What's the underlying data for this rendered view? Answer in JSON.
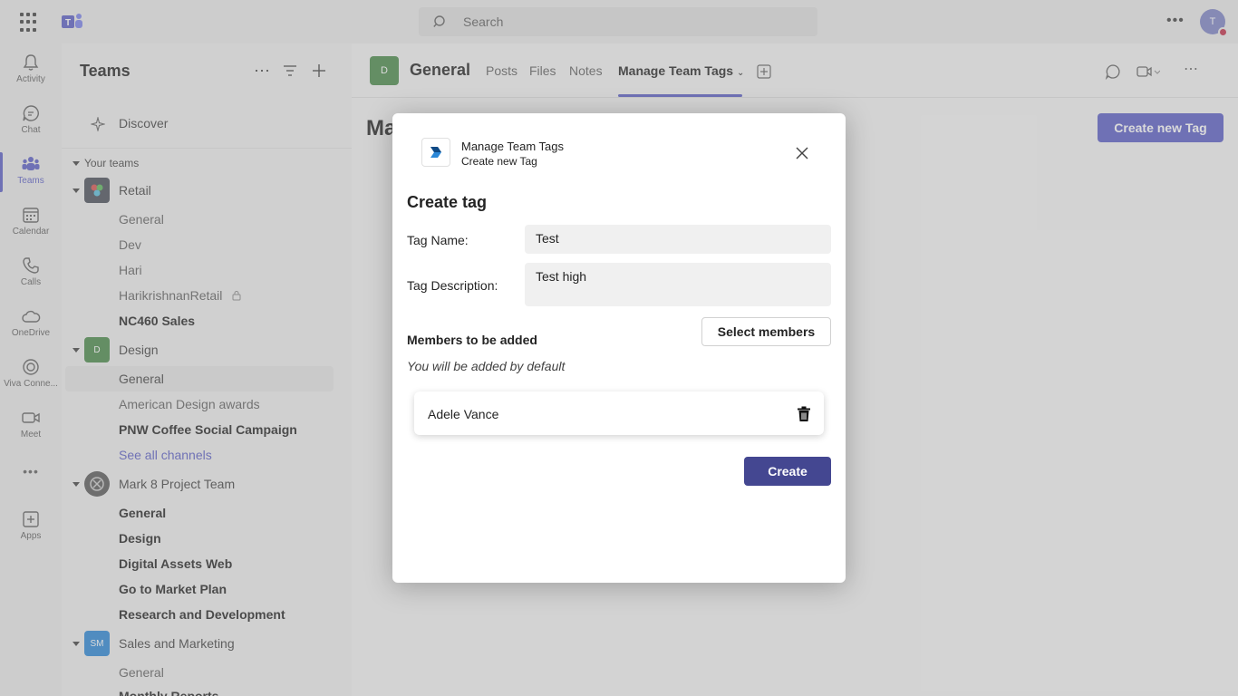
{
  "topbar": {
    "search_placeholder": "Search",
    "avatar_initials": "T"
  },
  "rail": [
    {
      "label": "Activity",
      "icon": "bell-icon"
    },
    {
      "label": "Chat",
      "icon": "chat-icon"
    },
    {
      "label": "Teams",
      "icon": "teams-icon"
    },
    {
      "label": "Calendar",
      "icon": "calendar-icon"
    },
    {
      "label": "Calls",
      "icon": "phone-icon"
    },
    {
      "label": "OneDrive",
      "icon": "cloud-icon"
    },
    {
      "label": "Viva Conne...",
      "icon": "viva-icon"
    },
    {
      "label": "Meet",
      "icon": "video-icon"
    },
    {
      "label": "Apps",
      "icon": "add-apps-icon"
    }
  ],
  "panel": {
    "title": "Teams",
    "discover": "Discover",
    "section": "Your teams",
    "teams": {
      "retail": {
        "name": "Retail",
        "channels": [
          "General",
          "Dev",
          "Hari",
          "HarikrishnanRetail",
          "NC460 Sales"
        ]
      },
      "design": {
        "name": "Design",
        "initial": "D",
        "channels": [
          "General",
          "American Design awards",
          "PNW Coffee Social Campaign",
          "See all channels"
        ]
      },
      "mark8": {
        "name": "Mark 8 Project Team",
        "channels": [
          "General",
          "Design",
          "Digital Assets Web",
          "Go to Market Plan",
          "Research and Development"
        ]
      },
      "sales": {
        "name": "Sales and Marketing",
        "initial": "SM",
        "channels": [
          "General",
          "Monthly Reports"
        ]
      }
    }
  },
  "header": {
    "channel_initial": "D",
    "channel_name": "General",
    "tabs": [
      "Posts",
      "Files",
      "Notes",
      "Manage Team Tags"
    ]
  },
  "background": {
    "create_new_tag": "Create new Tag",
    "title_fragment": "Ma"
  },
  "dialog": {
    "app_name": "Manage Team Tags",
    "app_subtitle": "Create new Tag",
    "title": "Create tag",
    "tag_name_label": "Tag Name:",
    "tag_name_value": "Test",
    "tag_desc_label": "Tag Description:",
    "tag_desc_value": "Test high",
    "select_members": "Select members",
    "members_heading": "Members to be added",
    "members_note": "You will be added by default",
    "members": [
      {
        "name": "Adele Vance"
      }
    ],
    "create": "Create"
  },
  "colors": {
    "accent": "#5b5fc7",
    "create_button": "#444791"
  }
}
